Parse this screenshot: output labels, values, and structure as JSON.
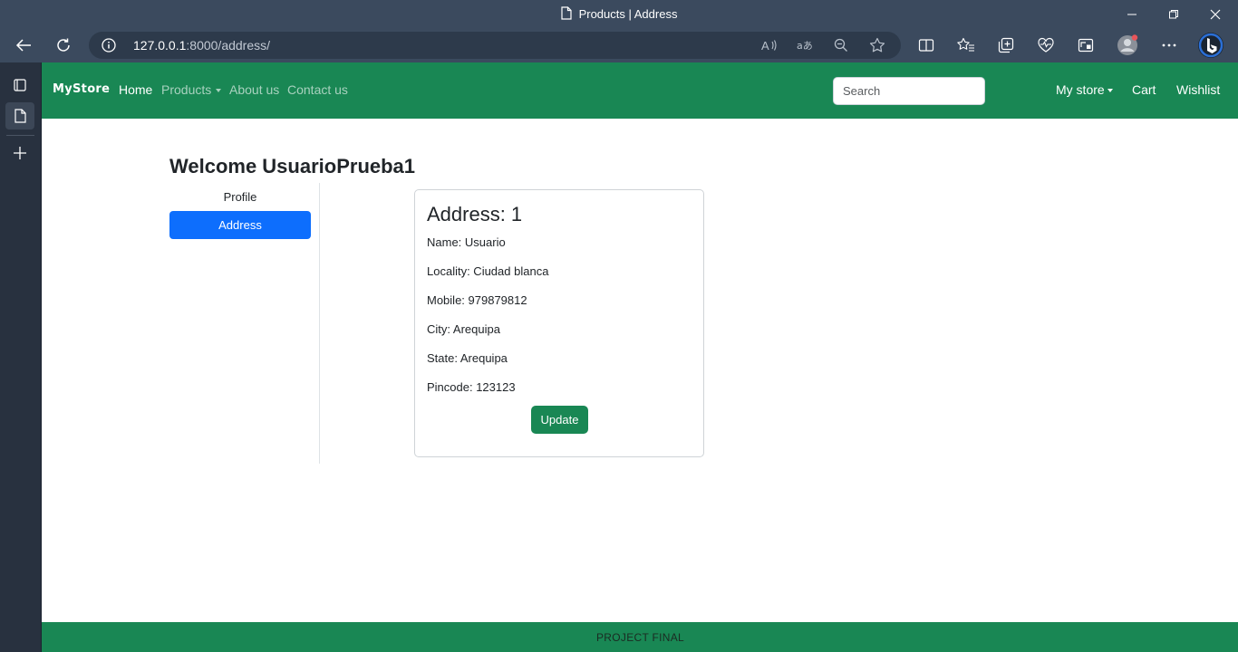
{
  "window": {
    "title": "Products | Address",
    "controls": [
      "minimize-icon",
      "restore-icon",
      "close-icon"
    ]
  },
  "browser": {
    "url_host": "127.0.0.1",
    "url_rest": ":8000/address/",
    "toolbar_icons": [
      "back-icon",
      "refresh-icon",
      "info-icon",
      "read-aloud-icon",
      "translate-icon",
      "zoom-out-icon",
      "favorite-star-icon",
      "split-screen-icon",
      "favorites-icon",
      "collections-icon",
      "browser-essentials-icon",
      "screenshot-icon",
      "profile-avatar-icon",
      "more-icon",
      "bing-icon"
    ],
    "sidebar_icons": [
      "tab-actions-icon",
      "page-tab-icon",
      "new-tab-icon"
    ]
  },
  "navbar": {
    "brand": "MyStore",
    "links": [
      "Home",
      "Products",
      "About us",
      "Contact us"
    ],
    "search_placeholder": "Search",
    "right_links": [
      "My store",
      "Cart",
      "Wishlist"
    ]
  },
  "page": {
    "welcome": "Welcome UsuarioPrueba1",
    "sidebar": [
      "Profile",
      "Address"
    ]
  },
  "address_card": {
    "title": "Address: 1",
    "lines": [
      "Name: Usuario",
      "Locality: Ciudad blanca",
      "Mobile: 979879812",
      "City: Arequipa",
      "State: Arequipa",
      "Pincode: 123123"
    ],
    "button": "Update"
  },
  "footer": {
    "text": "PROJECT FINAL"
  },
  "colors": {
    "navbar": "#198754",
    "active_sidebar": "#0d6efd",
    "browser_chrome": "#3b4a5e"
  }
}
